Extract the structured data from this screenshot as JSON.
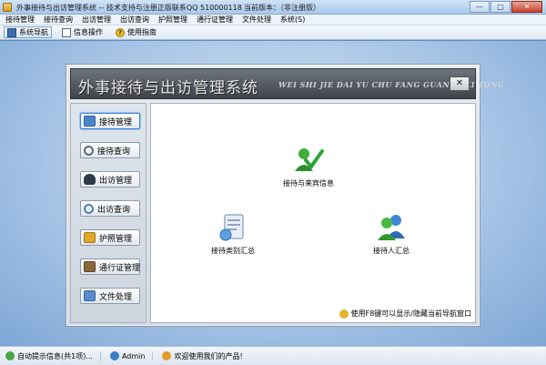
{
  "window": {
    "title": "外事接待与出访管理系统 -- 技术支持与注册正版联系QQ 510000118",
    "version_hint": "当前版本：（非注册版）",
    "buttons": {
      "minimize": "—",
      "maximize": "□",
      "close": "✕"
    }
  },
  "menu": [
    "接待管理",
    "接待查询",
    "出访管理",
    "出访查询",
    "护照管理",
    "通行证管理",
    "文件处理",
    "系统(S)"
  ],
  "toolbar": {
    "nav": "系统导航",
    "info": "信息操作",
    "help": "使用指南"
  },
  "panel": {
    "title": "外事接待与出访管理系统",
    "subtitle": "WEI SHI JIE DAI YU CHU FANG GUAN LI XI TONG",
    "close": "✕"
  },
  "sidebar": [
    {
      "label": "接待管理",
      "icon": "monitor-icon",
      "color": "#4b84c8"
    },
    {
      "label": "接待查询",
      "icon": "magnifier-icon",
      "color": "#7a8796"
    },
    {
      "label": "出访管理",
      "icon": "user-icon",
      "color": "#2f3a48"
    },
    {
      "label": "出访查询",
      "icon": "search-icon",
      "color": "#4a7fc0"
    },
    {
      "label": "护照管理",
      "icon": "star-icon",
      "color": "#e0a72a"
    },
    {
      "label": "通行证管理",
      "icon": "card-icon",
      "color": "#8a6a3b"
    },
    {
      "label": "文件处理",
      "icon": "document-icon",
      "color": "#5a8ccc"
    }
  ],
  "content": {
    "items": [
      {
        "label": "接待与来宾信息",
        "icon": "users-check-icon"
      },
      {
        "label": "接待类别汇总",
        "icon": "category-doc-icon"
      },
      {
        "label": "接待人汇总",
        "icon": "people-icon"
      }
    ],
    "hint": "使用F8键可以显示/隐藏当前导航窗口"
  },
  "status": {
    "tips": "自动提示信息(共1项)...",
    "user": "Admin",
    "welcome": "欢迎使用我们的产品!"
  },
  "colors": {
    "accent": "#3c7fd2",
    "header": "#4f555c",
    "green": "#3fae3a"
  }
}
